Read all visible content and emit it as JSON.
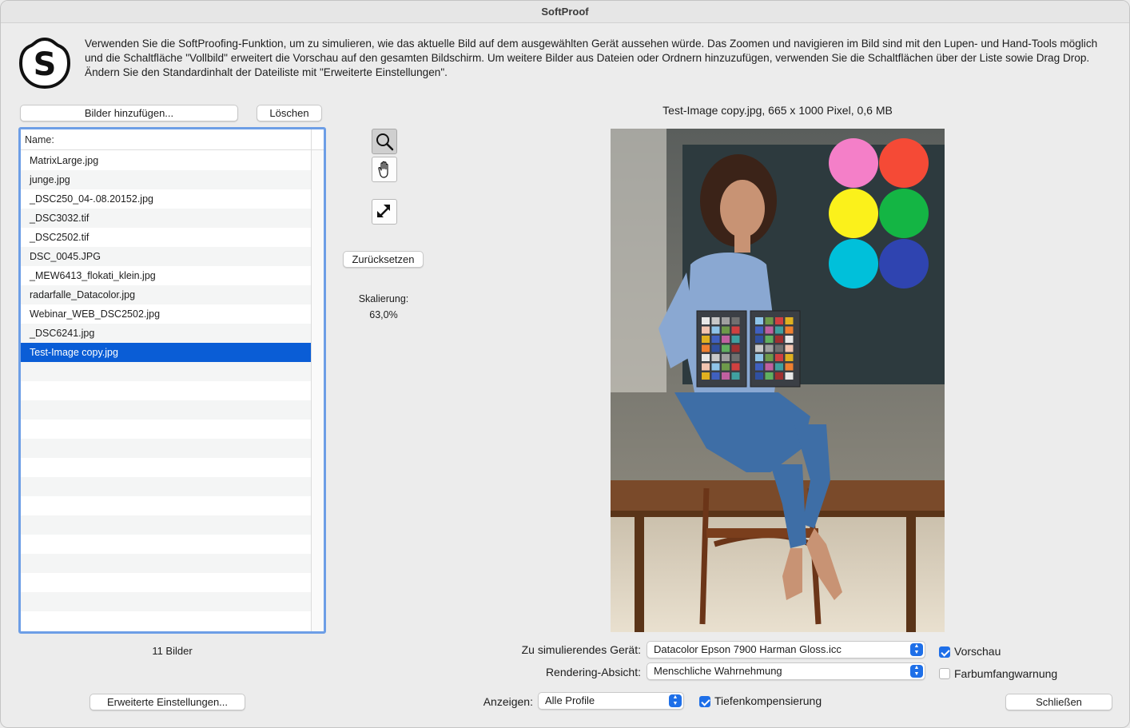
{
  "window": {
    "title": "SoftProof"
  },
  "intro": {
    "text": "Verwenden Sie die SoftProofing-Funktion, um zu simulieren, wie das aktuelle Bild auf dem ausgewählten Gerät aussehen würde. Das Zoomen und navigieren im Bild sind mit den Lupen- und Hand-Tools möglich und die Schaltfläche \"Vollbild\" erweitert die Vorschau auf den gesamten Bildschirm. Um weitere Bilder aus Dateien oder Ordnern hinzuzufügen, verwenden Sie die Schaltflächen über der Liste sowie Drag  Drop. Ändern Sie den Standardinhalt der Dateiliste mit \"Erweiterte Einstellungen\"."
  },
  "logo": {
    "letter": "S"
  },
  "file_panel": {
    "add_button": "Bilder hinzufügen...",
    "delete_button": "Löschen",
    "column_header": "Name:",
    "files": [
      "MatrixLarge.jpg",
      "junge.jpg",
      "_DSC250_04-.08.20152.jpg",
      "_DSC3032.tif",
      "_DSC2502.tif",
      "DSC_0045.JPG",
      "_MEW6413_flokati_klein.jpg",
      "radarfalle_Datacolor.jpg",
      "Webinar_WEB_DSC2502.jpg",
      "_DSC6241.jpg",
      "Test-Image copy.jpg"
    ],
    "selected_file": "Test-Image copy.jpg",
    "count_label": "11 Bilder",
    "advanced_button": "Erweiterte Einstellungen..."
  },
  "tools": {
    "zoom": "magnifier-icon",
    "hand": "hand-icon",
    "fullscreen": "expand-arrows-icon",
    "reset_button": "Zurücksetzen",
    "scaling_label": "Skalierung:",
    "scaling_value": "63,0%"
  },
  "preview": {
    "info": "Test-Image copy.jpg, 665 x 1000 Pixel, 0,6 MB",
    "circle_colors": [
      "#f47fc8",
      "#f54a36",
      "#fbf11b",
      "#14b544",
      "#00c0da",
      "#2f44b0"
    ]
  },
  "settings": {
    "device_label": "Zu simulierendes Gerät:",
    "device_value": "Datacolor Epson 7900 Harman Gloss.icc",
    "intent_label": "Rendering-Absicht:",
    "intent_value": "Menschliche Wahrnehmung",
    "show_label": "Anzeigen:",
    "show_value": "Alle Profile",
    "preview_check": {
      "label": "Vorschau",
      "checked": true
    },
    "gamut_check": {
      "label": "Farbumfangwarnung",
      "checked": false
    },
    "depth_check": {
      "label": "Tiefenkompensierung",
      "checked": true
    },
    "close_button": "Schließen"
  },
  "colors": {
    "accent": "#1e6fe8",
    "selection": "#0a5dd6",
    "list_border": "#6d9ee6"
  }
}
